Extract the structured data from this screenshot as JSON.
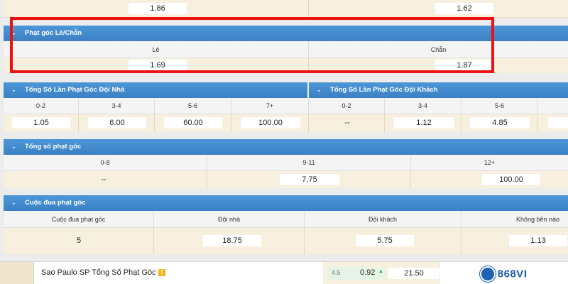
{
  "top_row": {
    "left_value": "1.86",
    "right_value": "1.62"
  },
  "odd_even": {
    "title": "Phạt góc Lẻ/Chẵn",
    "labels": [
      "Lẻ",
      "Chẵn"
    ],
    "values": [
      "1.69",
      "1.87"
    ]
  },
  "home_corners": {
    "title": "Tổng Số Lần Phạt Góc Đội Nhà",
    "labels": [
      "0-2",
      "3-4",
      "5-6",
      "7+"
    ],
    "values": [
      "1.05",
      "6.00",
      "60.00",
      "100.00"
    ]
  },
  "away_corners": {
    "title": "Tổng Số Lần Phạt Góc Đội Khách",
    "labels": [
      "0-2",
      "3-4",
      "5-6"
    ],
    "values": [
      "--",
      "1.12",
      "4.85"
    ]
  },
  "total_corners": {
    "title": "Tổng số phạt góc",
    "labels": [
      "0-8",
      "9-11",
      "12+"
    ],
    "values": [
      "--",
      "7.75",
      "100.00"
    ]
  },
  "corner_race": {
    "title": "Cuộc đua phạt góc",
    "labels": [
      "Cuộc đua phạt góc",
      "Đội nhà",
      "Đội khách",
      "Không bên nào"
    ],
    "row_label": "5",
    "values": [
      "18.75",
      "5.75",
      "1.13"
    ]
  },
  "bottom": {
    "match_title": "Sao Paulo SP Tổng Số Phạt Góc",
    "warn_badge": "!",
    "handicap": "4.5",
    "odds_a": "0.92",
    "odds_b": "21.50",
    "logo_text": "868VI"
  },
  "colors": {
    "header_blue": "#3f86c9",
    "highlight_red": "#ee1111",
    "odds_bg": "#f7f0de"
  }
}
